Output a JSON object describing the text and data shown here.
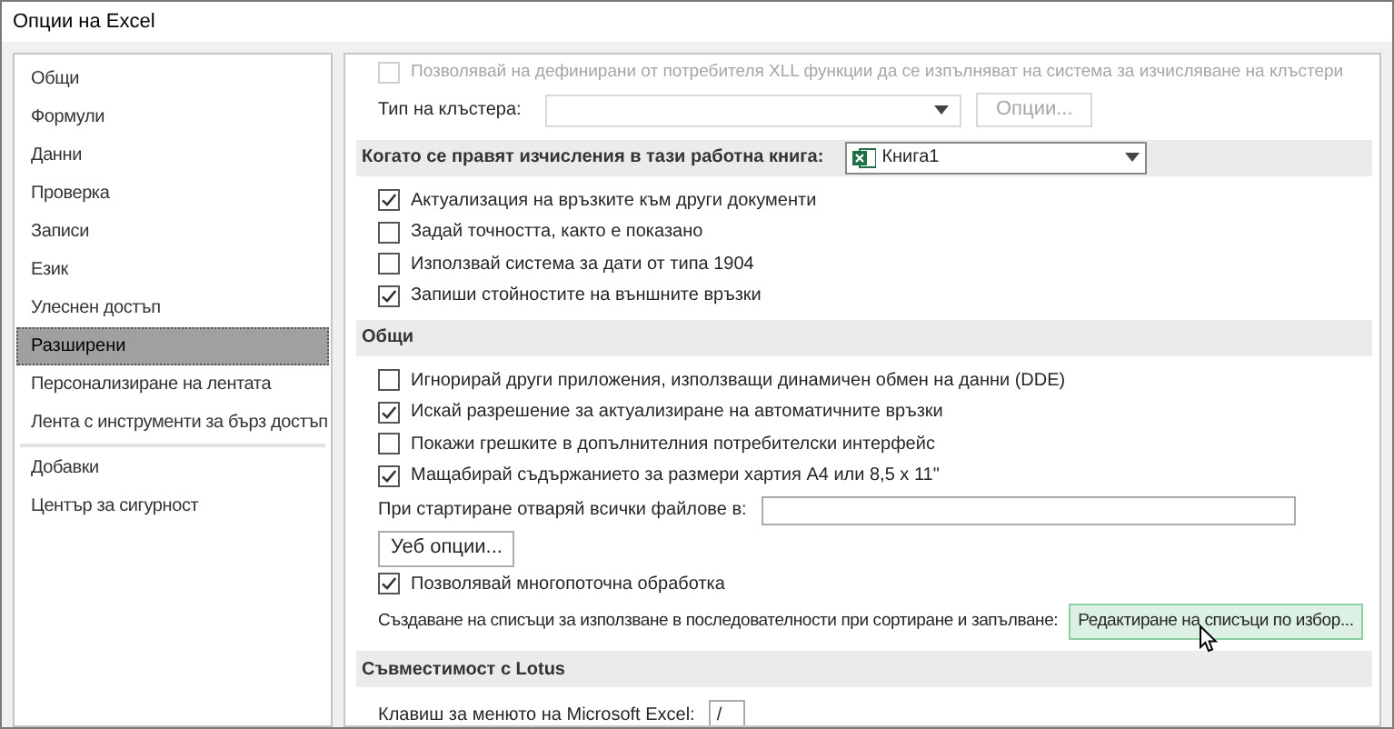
{
  "window": {
    "title": "Опции на Excel"
  },
  "sidebar": {
    "groups": [
      [
        {
          "label": "Общи",
          "selected": false
        },
        {
          "label": "Формули",
          "selected": false
        },
        {
          "label": "Данни",
          "selected": false
        },
        {
          "label": "Проверка",
          "selected": false
        },
        {
          "label": "Записи",
          "selected": false
        },
        {
          "label": "Език",
          "selected": false
        },
        {
          "label": "Улеснен достъп",
          "selected": false
        },
        {
          "label": "Разширени",
          "selected": true
        },
        {
          "label": "Персонализиране на лентата",
          "selected": false
        },
        {
          "label": "Лента с инструменти за бърз достъп",
          "selected": false
        }
      ],
      [
        {
          "label": "Добавки",
          "selected": false
        },
        {
          "label": "Център за сигурност",
          "selected": false
        }
      ]
    ]
  },
  "content": [
    {
      "kind": "checkbox",
      "label": "Позволявай на дефинирани от потребителя XLL функции да се изпълняват на система за изчисляване на клъстери",
      "checked": false,
      "disabled": true
    },
    {
      "kind": "select",
      "label": "Тип на клъстера:",
      "disabled": true,
      "button": "Опции..."
    },
    {
      "kind": "section",
      "title": "Когато се правят изчисления в тази работна книга:",
      "workbook": "Книга1"
    },
    {
      "kind": "checkbox",
      "label": "Актуализация на връзките към други документи",
      "checked": true,
      "disabled": false
    },
    {
      "kind": "checkbox",
      "label": "Задай точността, както е показано",
      "checked": false,
      "disabled": false
    },
    {
      "kind": "checkbox",
      "label": "Използвай система за дати от типа 1904",
      "checked": false,
      "disabled": false
    },
    {
      "kind": "checkbox",
      "label": "Запиши стойностите на външните връзки",
      "checked": true,
      "disabled": false
    },
    {
      "kind": "section",
      "title": "Общи"
    },
    {
      "kind": "checkbox",
      "label": "Игнорирай други приложения, използващи динамичен обмен на данни (DDE)",
      "checked": false,
      "disabled": false
    },
    {
      "kind": "checkbox",
      "label": "Искай разрешение за актуализиране на автоматичните връзки",
      "checked": true,
      "disabled": false
    },
    {
      "kind": "checkbox",
      "label": "Покажи грешките в допълнителния потребителски интерфейс",
      "checked": false,
      "disabled": false
    },
    {
      "kind": "checkbox",
      "label": "Мащабирай съдържанието за размери хартия А4 или 8,5 x 11\"",
      "checked": true,
      "disabled": false
    },
    {
      "kind": "field",
      "label": "При стартиране отваряй всички файлове в:"
    },
    {
      "kind": "button",
      "label": "Уеб опции..."
    },
    {
      "kind": "checkbox",
      "label": "Позволявай многопоточна обработка",
      "checked": true,
      "disabled": false
    },
    {
      "kind": "label_button",
      "label": "Създаване на списъци за използване в последователности при сортиране и запълване:",
      "button": "Редактиране на списъци по избор...",
      "hovered": true
    },
    {
      "kind": "section",
      "title": "Съвместимост с Lotus"
    },
    {
      "kind": "short_field",
      "label": "Клавиш за менюто на Microsoft Excel:",
      "value": "/"
    }
  ]
}
